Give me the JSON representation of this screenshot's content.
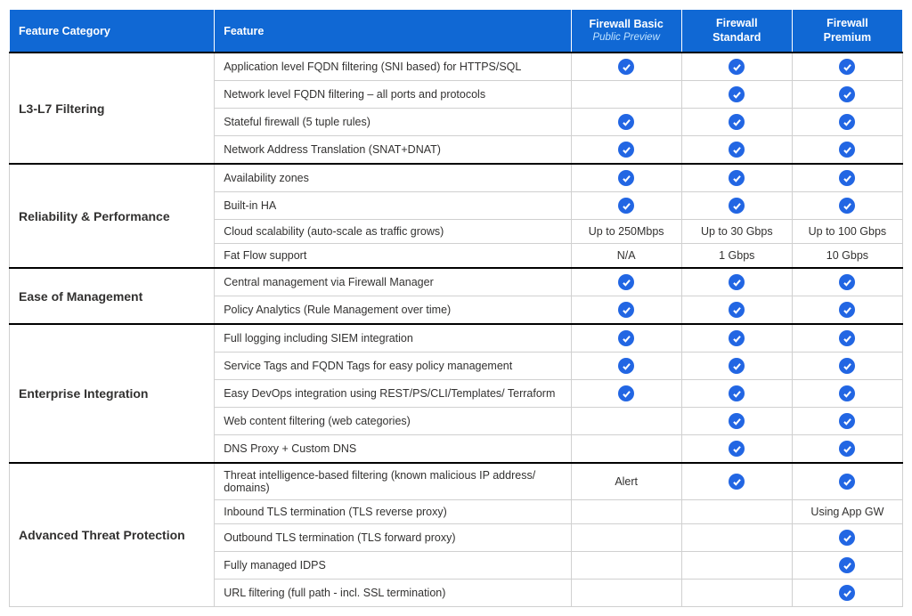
{
  "headers": {
    "category": "Feature Category",
    "feature": "Feature",
    "tiers": [
      {
        "name": "Firewall Basic",
        "note": "Public Preview"
      },
      {
        "name": "Firewall Standard",
        "note": ""
      },
      {
        "name": "Firewall Premium",
        "note": ""
      }
    ]
  },
  "groups": [
    {
      "category": "L3-L7 Filtering",
      "rows": [
        {
          "feature": "Application level FQDN filtering (SNI based) for HTTPS/SQL",
          "cells": [
            "check",
            "check",
            "check"
          ]
        },
        {
          "feature": "Network level FQDN filtering – all ports and protocols",
          "cells": [
            "",
            "check",
            "check"
          ]
        },
        {
          "feature": "Stateful firewall (5 tuple rules)",
          "cells": [
            "check",
            "check",
            "check"
          ]
        },
        {
          "feature": "Network Address Translation (SNAT+DNAT)",
          "cells": [
            "check",
            "check",
            "check"
          ]
        }
      ]
    },
    {
      "category": "Reliability & Performance",
      "rows": [
        {
          "feature": "Availability zones",
          "cells": [
            "check",
            "check",
            "check"
          ]
        },
        {
          "feature": "Built-in HA",
          "cells": [
            "check",
            "check",
            "check"
          ]
        },
        {
          "feature": "Cloud scalability (auto-scale as traffic grows)",
          "cells": [
            "Up to 250Mbps",
            "Up to 30 Gbps",
            "Up to 100 Gbps"
          ]
        },
        {
          "feature": "Fat Flow support",
          "cells": [
            "N/A",
            "1 Gbps",
            "10 Gbps"
          ]
        }
      ]
    },
    {
      "category": "Ease of Management",
      "rows": [
        {
          "feature": "Central management via Firewall Manager",
          "cells": [
            "check",
            "check",
            "check"
          ]
        },
        {
          "feature": "Policy Analytics (Rule Management over time)",
          "cells": [
            "check",
            "check",
            "check"
          ]
        }
      ]
    },
    {
      "category": "Enterprise Integration",
      "rows": [
        {
          "feature": "Full logging including SIEM integration",
          "cells": [
            "check",
            "check",
            "check"
          ]
        },
        {
          "feature": "Service Tags and FQDN Tags for easy policy management",
          "cells": [
            "check",
            "check",
            "check"
          ]
        },
        {
          "feature": "Easy DevOps integration using REST/PS/CLI/Templates/ Terraform",
          "cells": [
            "check",
            "check",
            "check"
          ]
        },
        {
          "feature": "Web content filtering (web categories)",
          "cells": [
            "",
            "check",
            "check"
          ]
        },
        {
          "feature": "DNS Proxy + Custom DNS",
          "cells": [
            "",
            "check",
            "check"
          ]
        }
      ]
    },
    {
      "category": "Advanced Threat Protection",
      "rows": [
        {
          "feature": "Threat intelligence-based filtering (known malicious IP address/ domains)",
          "cells": [
            "Alert",
            "check",
            "check"
          ]
        },
        {
          "feature": "Inbound TLS termination (TLS reverse proxy)",
          "cells": [
            "",
            "",
            "Using App GW"
          ]
        },
        {
          "feature": "Outbound TLS termination (TLS forward proxy)",
          "cells": [
            "",
            "",
            "check"
          ]
        },
        {
          "feature": "Fully managed IDPS",
          "cells": [
            "",
            "",
            "check"
          ]
        },
        {
          "feature": "URL filtering (full path - incl. SSL termination)",
          "cells": [
            "",
            "",
            "check"
          ]
        }
      ]
    }
  ]
}
